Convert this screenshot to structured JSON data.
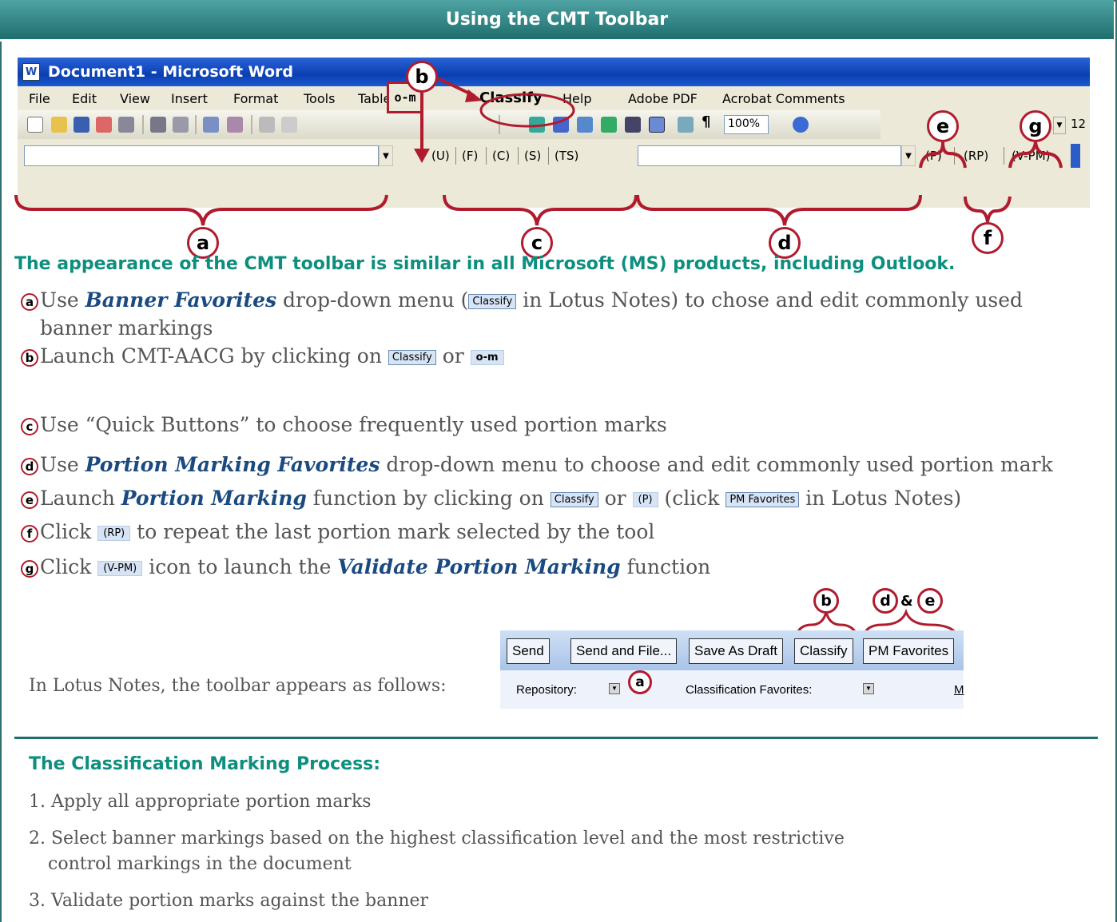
{
  "title": "Using the CMT Toolbar",
  "word": {
    "window_title": "Document1 - Microsoft Word",
    "menus": [
      "File",
      "Edit",
      "View",
      "Insert",
      "Format",
      "Tools",
      "Table",
      "Classify",
      "Help",
      "Adobe PDF",
      "Acrobat Comments"
    ],
    "zoom": "100%",
    "font_size": "12",
    "key_glyph": "o-m",
    "quick_buttons": [
      "(U)",
      "(F)",
      "(C)",
      "(S)",
      "(TS)"
    ],
    "pm_buttons": [
      "(P)",
      "(RP)",
      "(V-PM)"
    ]
  },
  "callouts": {
    "a": "a",
    "b": "b",
    "c": "c",
    "d": "d",
    "e": "e",
    "f": "f",
    "g": "g",
    "amp": "&"
  },
  "heading": "The appearance of the CMT toolbar is similar in all Microsoft (MS) products, including Outlook.",
  "bullets": {
    "a": {
      "pre": "Use ",
      "em": "Banner Favorites",
      "mid": " drop-down menu (",
      "btn": "Classify",
      "post": " in Lotus Notes) to chose and edit commonly used",
      "line2": "banner markings"
    },
    "b": {
      "pre": "Launch CMT-AACG by clicking on ",
      "btn": "Classify",
      "mid": " or ",
      "key": "o-m"
    },
    "c": {
      "pre": "Use “Quick Buttons” to choose frequently used portion marks"
    },
    "d": {
      "pre": "Use ",
      "em": "Portion Marking Favorites",
      "post": " drop-down menu to choose and edit commonly used portion mark"
    },
    "e": {
      "pre": "Launch ",
      "em": "Portion Marking",
      "mid": " function by clicking on ",
      "btn": "Classify",
      "or": " or ",
      "btn2": "(P)",
      "mid2": " (click ",
      "btn3": "PM Favorites",
      "post": " in Lotus Notes)"
    },
    "f": {
      "pre": "Click ",
      "btn": "(RP)",
      "post": " to repeat the last portion mark selected by the tool"
    },
    "g": {
      "pre": "Click ",
      "btn": "(V-PM)",
      "mid": " icon to launch the ",
      "em": "Validate Portion Marking",
      "post": " function"
    }
  },
  "lotus": {
    "label": "In Lotus Notes, the toolbar appears as follows:",
    "buttons": [
      "Send",
      "Send and File...",
      "Save As Draft",
      "Classify",
      "PM Favorites"
    ],
    "repository": "Repository:",
    "favorites": "Classification Favorites:",
    "m": "M"
  },
  "process": {
    "heading": "The Classification Marking Process:",
    "steps": [
      "1. Apply all appropriate portion marks",
      "2. Select banner markings based on the highest classification level and the most restrictive",
      "control markings in the document",
      "3. Validate portion marks against the banner"
    ]
  }
}
